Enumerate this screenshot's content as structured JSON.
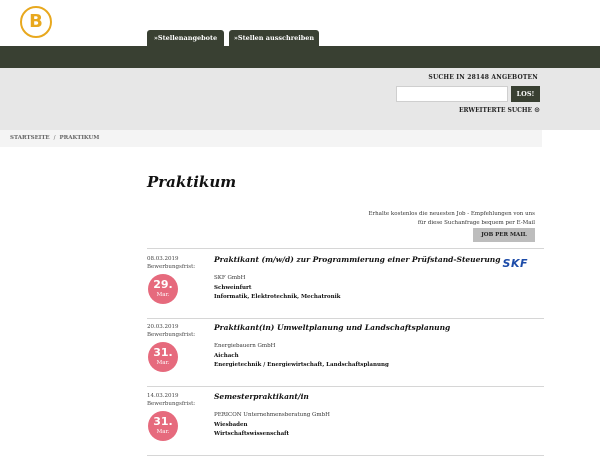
{
  "header": {
    "logo_letter": "B",
    "tabs": [
      {
        "label": "»Stellenangebote"
      },
      {
        "label": "»Stellen ausschreiben"
      }
    ]
  },
  "search": {
    "title": "SUCHE IN 28148 ANGEBOTEN",
    "input_value": "",
    "button_label": "LOS!",
    "advanced_label": "ERWEITERTE SUCHE",
    "advanced_icon": "⊙"
  },
  "breadcrumb": {
    "home": "STARTSEITE",
    "separator": "/",
    "current": "PRAKTIKUM"
  },
  "page": {
    "title": "Praktikum",
    "alert_text": "Erhalte kostenlos die neuesten Job - Empfehlungen von uns für diese Suchanfrage bequem per E-Mail",
    "alert_button": "JOB PER MAIL"
  },
  "jobs": [
    {
      "date": "08.03.2019",
      "deadline_label": "Bewerbungsfrist:",
      "deadline_day": "29.",
      "deadline_month": "Mar.",
      "title": "Praktikant (m/w/d) zur Programmierung einer Prüfstand-Steuerung",
      "company": "SKF GmbH",
      "city": "Schweinfurt",
      "field": "Informatik, Elektrotechnik, Mechatronik",
      "logo_text": "SKF"
    },
    {
      "date": "20.03.2019",
      "deadline_label": "Bewerbungsfrist:",
      "deadline_day": "31.",
      "deadline_month": "Mar.",
      "title": "Praktikant(in) Umweltplanung und Landschaftsplanung",
      "company": "Energiebauern GmbH",
      "city": "Aichach",
      "field": "Energietechnik / Energiewirtschaft, Landschaftsplanung"
    },
    {
      "date": "14.03.2019",
      "deadline_label": "Bewerbungsfrist:",
      "deadline_day": "31.",
      "deadline_month": "Mar.",
      "title": "Semesterpraktikant/in",
      "company": "PERICON Unternehmensberatung GmbH",
      "city": "Wiesbaden",
      "field": "Wirtschaftswissenschaft"
    }
  ],
  "colors": {
    "dark_green": "#394032",
    "logo_gold": "#e8a81e",
    "badge_pink": "#e66a7d",
    "skf_blue": "#1c4ba8"
  }
}
